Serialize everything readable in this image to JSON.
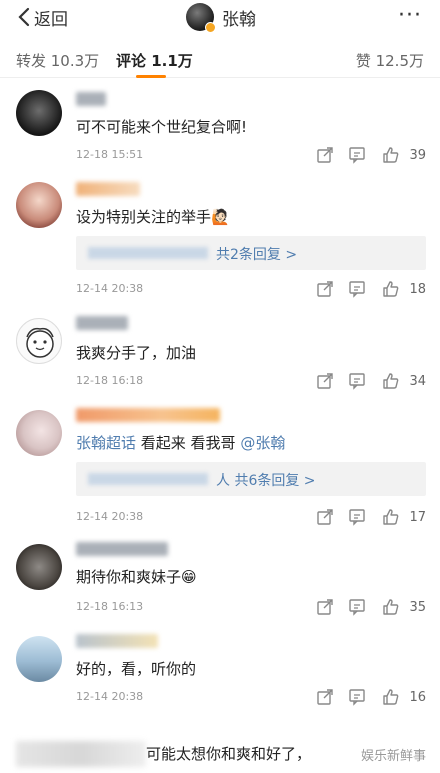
{
  "header": {
    "back_label": "返回",
    "title": "张翰",
    "more_label": "···"
  },
  "tabs": [
    {
      "label": "转发 10.3万"
    },
    {
      "label": "评论 1.1万"
    },
    {
      "label": "赞 12.5万"
    }
  ],
  "comments": [
    {
      "text": "可不可能来个世纪复合啊!",
      "time": "12-18 15:51",
      "likes": "39"
    },
    {
      "text": "设为特别关注的举手🙋🏻",
      "reply_label": "共2条回复 >",
      "time": "12-14 20:38",
      "likes": "18"
    },
    {
      "text": "我爽分手了，加油",
      "time": "12-18 16:18",
      "likes": "34"
    },
    {
      "text_link": "张翰超话",
      "text_mid": " 看起来 看我哥 ",
      "text_mention": "@张翰",
      "reply_label": "人 共6条回复 >",
      "time": "12-14 20:38",
      "likes": "17"
    },
    {
      "text": "期待你和爽妹子😁",
      "time": "12-18 16:13",
      "likes": "35"
    },
    {
      "text": "好的，看，听你的",
      "time": "12-14 20:38",
      "likes": "16"
    },
    {
      "text": "可能太想你和爽和好了，"
    }
  ],
  "watermark": "娱乐新鲜事",
  "colors": {
    "accent": "#ff8200",
    "link": "#507daf"
  }
}
